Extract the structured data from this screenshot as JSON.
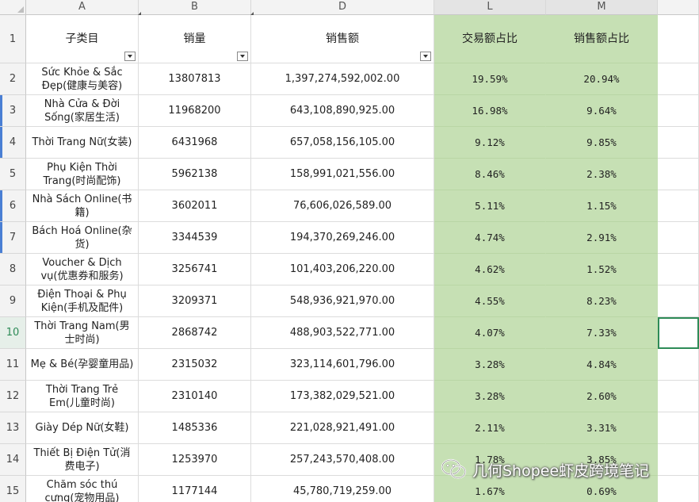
{
  "columns": [
    "A",
    "B",
    "D",
    "L",
    "M"
  ],
  "headers": {
    "subcategory": "子类目",
    "sales_volume": "销量",
    "sales_amount": "销售额",
    "transaction_share": "交易额占比",
    "sales_share": "销售额占比"
  },
  "header_row_number": "1",
  "rows": [
    {
      "num": "2",
      "subcategory": "Sức Khỏe & Sắc Đẹp(健康与美容)",
      "volume": "13807813",
      "amount": "1,397,274,592,002.00",
      "txn_share": "19.59%",
      "sales_share": "20.94%"
    },
    {
      "num": "3",
      "subcategory": "Nhà Cửa & Đời Sống(家居生活)",
      "volume": "11968200",
      "amount": "643,108,890,925.00",
      "txn_share": "16.98%",
      "sales_share": "9.64%"
    },
    {
      "num": "4",
      "subcategory": "Thời Trang Nữ(女装)",
      "volume": "6431968",
      "amount": "657,058,156,105.00",
      "txn_share": "9.12%",
      "sales_share": "9.85%"
    },
    {
      "num": "5",
      "subcategory": "Phụ Kiện Thời Trang(时尚配饰)",
      "volume": "5962138",
      "amount": "158,991,021,556.00",
      "txn_share": "8.46%",
      "sales_share": "2.38%"
    },
    {
      "num": "6",
      "subcategory": "Nhà Sách Online(书籍)",
      "volume": "3602011",
      "amount": "76,606,026,589.00",
      "txn_share": "5.11%",
      "sales_share": "1.15%"
    },
    {
      "num": "7",
      "subcategory": "Bách Hoá Online(杂货)",
      "volume": "3344539",
      "amount": "194,370,269,246.00",
      "txn_share": "4.74%",
      "sales_share": "2.91%"
    },
    {
      "num": "8",
      "subcategory": "Voucher & Dịch vụ(优惠券和服务)",
      "volume": "3256741",
      "amount": "101,403,206,220.00",
      "txn_share": "4.62%",
      "sales_share": "1.52%"
    },
    {
      "num": "9",
      "subcategory": "Điện Thoại & Phụ Kiện(手机及配件)",
      "volume": "3209371",
      "amount": "548,936,921,970.00",
      "txn_share": "4.55%",
      "sales_share": "8.23%"
    },
    {
      "num": "10",
      "subcategory": "Thời Trang Nam(男士时尚)",
      "volume": "2868742",
      "amount": "488,903,522,771.00",
      "txn_share": "4.07%",
      "sales_share": "7.33%"
    },
    {
      "num": "11",
      "subcategory": "Mẹ & Bé(孕婴童用品)",
      "volume": "2315032",
      "amount": "323,114,601,796.00",
      "txn_share": "3.28%",
      "sales_share": "4.84%"
    },
    {
      "num": "12",
      "subcategory": "Thời Trang Trẻ Em(儿童时尚)",
      "volume": "2310140",
      "amount": "173,382,029,521.00",
      "txn_share": "3.28%",
      "sales_share": "2.60%"
    },
    {
      "num": "13",
      "subcategory": "Giày Dép Nữ(女鞋)",
      "volume": "1485336",
      "amount": "221,028,921,491.00",
      "txn_share": "2.11%",
      "sales_share": "3.31%"
    },
    {
      "num": "14",
      "subcategory": "Thiết Bị Điện Tử(消费电子)",
      "volume": "1253970",
      "amount": "257,243,570,408.00",
      "txn_share": "1.78%",
      "sales_share": "3.85%"
    },
    {
      "num": "15",
      "subcategory": "Chăm sóc thú cưng(宠物用品)",
      "volume": "1177144",
      "amount": "45,780,719,259.00",
      "txn_share": "1.67%",
      "sales_share": "0.69%"
    }
  ],
  "active_row": "10",
  "highlight_color": "#c6e0b4",
  "watermark": {
    "text": "几何Shopee虾皮跨境笔记",
    "icon": "wechat-icon"
  }
}
